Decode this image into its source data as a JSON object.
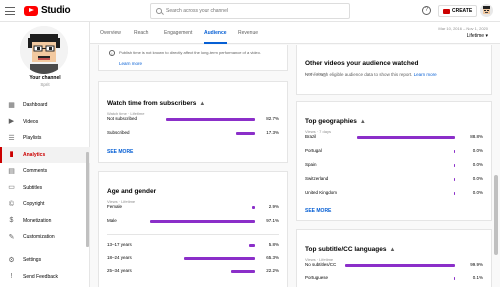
{
  "header": {
    "logo_text": "Studio",
    "search_placeholder": "Search across your channel",
    "create_label": "CREATE"
  },
  "sidebar": {
    "channel_name": "Your channel",
    "channel_sub": "Sprit",
    "items": [
      {
        "label": "Dashboard",
        "icon": "dashboard-icon",
        "glyph": "▦"
      },
      {
        "label": "Videos",
        "icon": "videos-icon",
        "glyph": "▶"
      },
      {
        "label": "Playlists",
        "icon": "playlists-icon",
        "glyph": "☰"
      },
      {
        "label": "Analytics",
        "icon": "analytics-icon",
        "glyph": "▮"
      },
      {
        "label": "Comments",
        "icon": "comments-icon",
        "glyph": "▤"
      },
      {
        "label": "Subtitles",
        "icon": "subtitles-icon",
        "glyph": "▭"
      },
      {
        "label": "Copyright",
        "icon": "copyright-icon",
        "glyph": "©"
      },
      {
        "label": "Monetization",
        "icon": "monetization-icon",
        "glyph": "$"
      },
      {
        "label": "Customization",
        "icon": "customization-icon",
        "glyph": "✎"
      }
    ],
    "bottom_items": [
      {
        "label": "Settings",
        "icon": "gear-icon",
        "glyph": "⚙"
      },
      {
        "label": "Send Feedback",
        "icon": "feedback-icon",
        "glyph": "!"
      }
    ]
  },
  "tabs": [
    "Overview",
    "Reach",
    "Engagement",
    "Audience",
    "Revenue"
  ],
  "date_range": {
    "dates": "Mar 10, 2016 – Nov 1, 2020",
    "label": "Lifetime"
  },
  "cards": {
    "top_note": {
      "text": "Publish time is not known to directly affect the long-term performance of a video.",
      "link": "Learn more"
    },
    "watch_time": {
      "title": "Watch time from subscribers",
      "sub": "Watch time · Lifetime",
      "rows": [
        {
          "label": "Not subscribed",
          "value": 82.7,
          "pct": "82.7%"
        },
        {
          "label": "Subscribed",
          "value": 17.3,
          "pct": "17.3%"
        }
      ],
      "see_more": "SEE MORE"
    },
    "age_gender": {
      "title": "Age and gender",
      "sub": "Views · Lifetime",
      "gender_rows": [
        {
          "label": "Female",
          "value": 2.9,
          "pct": "2.9%"
        },
        {
          "label": "Male",
          "value": 97.1,
          "pct": "97.1%"
        }
      ],
      "age_rows": [
        {
          "label": "13–17 years",
          "value": 5.8,
          "pct": "5.8%"
        },
        {
          "label": "18–24 years",
          "value": 65.3,
          "pct": "65.3%"
        },
        {
          "label": "25–34 years",
          "value": 22.2,
          "pct": "22.2%"
        }
      ]
    },
    "other_videos": {
      "title": "Other videos your audience watched",
      "sub": "Last 7 days",
      "text": "Not enough eligible audience data to show this report.",
      "link": "Learn more"
    },
    "geographies": {
      "title": "Top geographies",
      "sub": "Views · 7 days",
      "rows": [
        {
          "label": "Brazil",
          "value": 88.8,
          "pct": "88.8%"
        },
        {
          "label": "Portugal",
          "value": 0,
          "pct": "0.0%"
        },
        {
          "label": "Spain",
          "value": 0,
          "pct": "0.0%"
        },
        {
          "label": "Switzerland",
          "value": 0,
          "pct": "0.0%"
        },
        {
          "label": "United Kingdom",
          "value": 0,
          "pct": "0.0%"
        }
      ],
      "see_more": "SEE MORE"
    },
    "subtitles": {
      "title": "Top subtitle/CC languages",
      "sub": "Views · Lifetime",
      "rows": [
        {
          "label": "No subtitles/CC",
          "value": 99.9,
          "pct": "99.9%"
        },
        {
          "label": "Portuguese",
          "value": 0.1,
          "pct": "0.1%"
        }
      ]
    }
  },
  "colors": {
    "accent": "#065fd4",
    "bar": "#8b2fc9",
    "brand": "#ff0000"
  }
}
